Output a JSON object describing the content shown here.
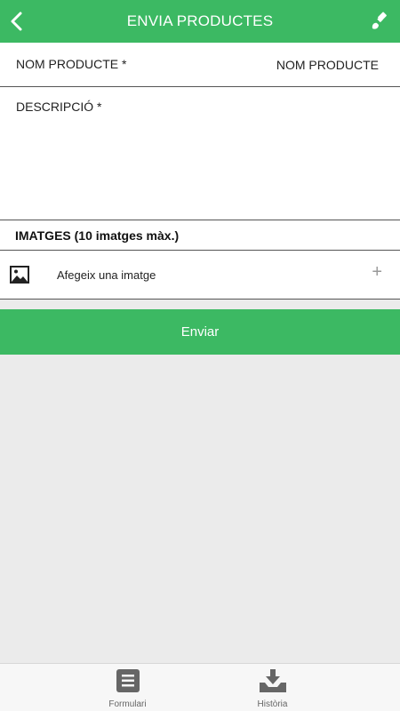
{
  "header": {
    "title": "ENVIA PRODUCTES",
    "color": "#3cb963"
  },
  "form": {
    "name_label": "NOM PRODUCTE *",
    "name_placeholder": "NOM PRODUCTE",
    "description_label": "DESCRIPCIÓ *",
    "images_label": "IMATGES (10 imatges màx.)",
    "add_image_label": "Afegeix una imatge",
    "add_image_plus": "+"
  },
  "submit_label": "Enviar",
  "tabs": [
    {
      "label": "Formulari",
      "icon": "form-icon"
    },
    {
      "label": "Història",
      "icon": "download-tray-icon"
    }
  ]
}
